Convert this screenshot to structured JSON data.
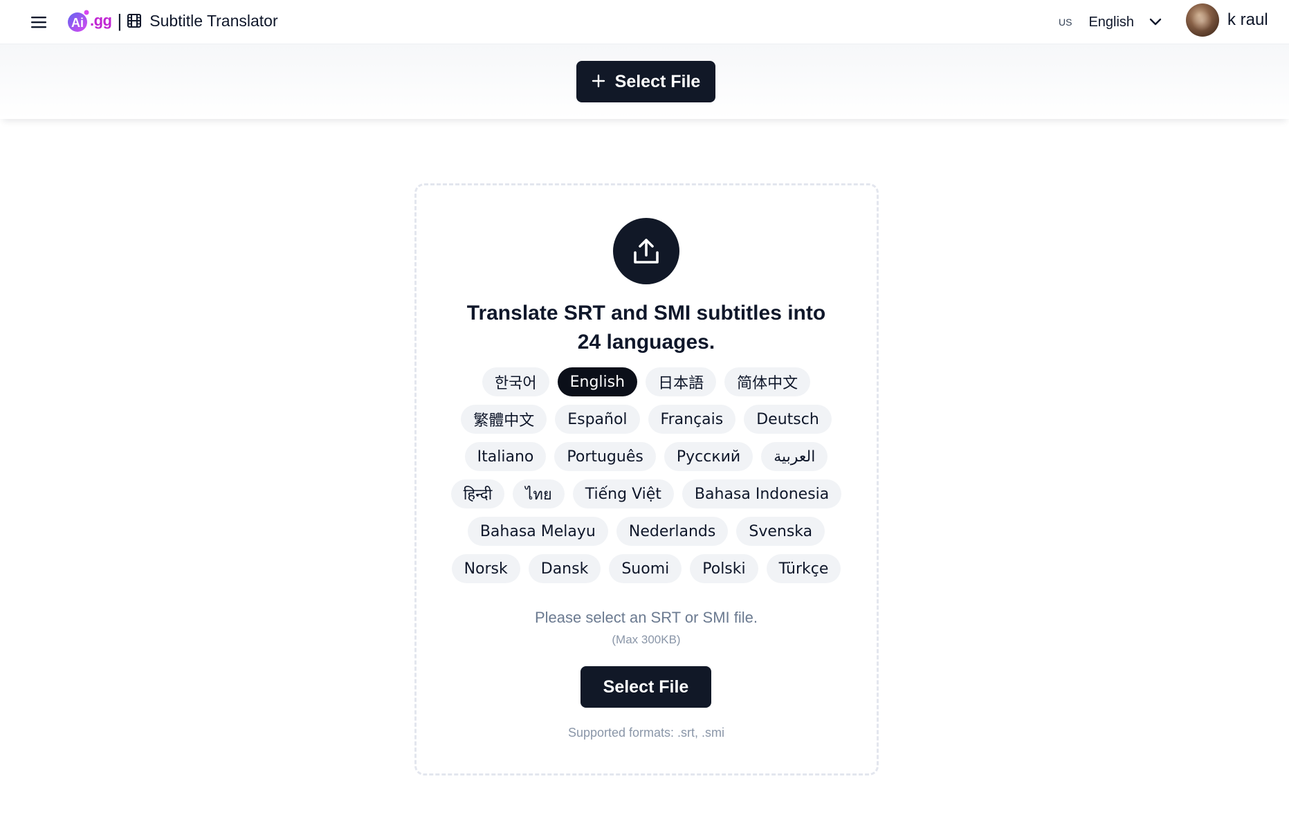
{
  "header": {
    "logo_ai": "Ai",
    "logo_gg": ".gg",
    "separator": "|",
    "app_title": "Subtitle Translator",
    "lang_flag": "US",
    "lang_label": "English",
    "user_name": "k raul"
  },
  "band": {
    "select_label": "Select File"
  },
  "card": {
    "headline": "Translate SRT and SMI subtitles into 24 languages.",
    "languages": [
      [
        "한국어",
        "English",
        "日本語",
        "简体中文"
      ],
      [
        "繁體中文",
        "Español",
        "Français",
        "Deutsch"
      ],
      [
        "Italiano",
        "Português",
        "Русский",
        "العربية"
      ],
      [
        "हिन्दी",
        "ไทย",
        "Tiếng Việt",
        "Bahasa Indonesia"
      ],
      [
        "Bahasa Melayu",
        "Nederlands",
        "Svenska"
      ],
      [
        "Norsk",
        "Dansk",
        "Suomi",
        "Polski",
        "Türkçe"
      ]
    ],
    "active_language": "English",
    "hint": "Please select an SRT or SMI file.",
    "max_size": "(Max 300KB)",
    "select_label": "Select File",
    "formats": "Supported formats: .srt, .smi"
  },
  "colors": {
    "primary": "#111827",
    "chip_bg": "#f1f3f6",
    "muted_text": "#6b7a90",
    "brand": "#c026d3"
  },
  "icons": {
    "menu": "hamburger-menu-icon",
    "film": "film-icon",
    "chevron": "chevron-down-icon",
    "plus": "plus-icon",
    "upload": "upload-icon"
  }
}
